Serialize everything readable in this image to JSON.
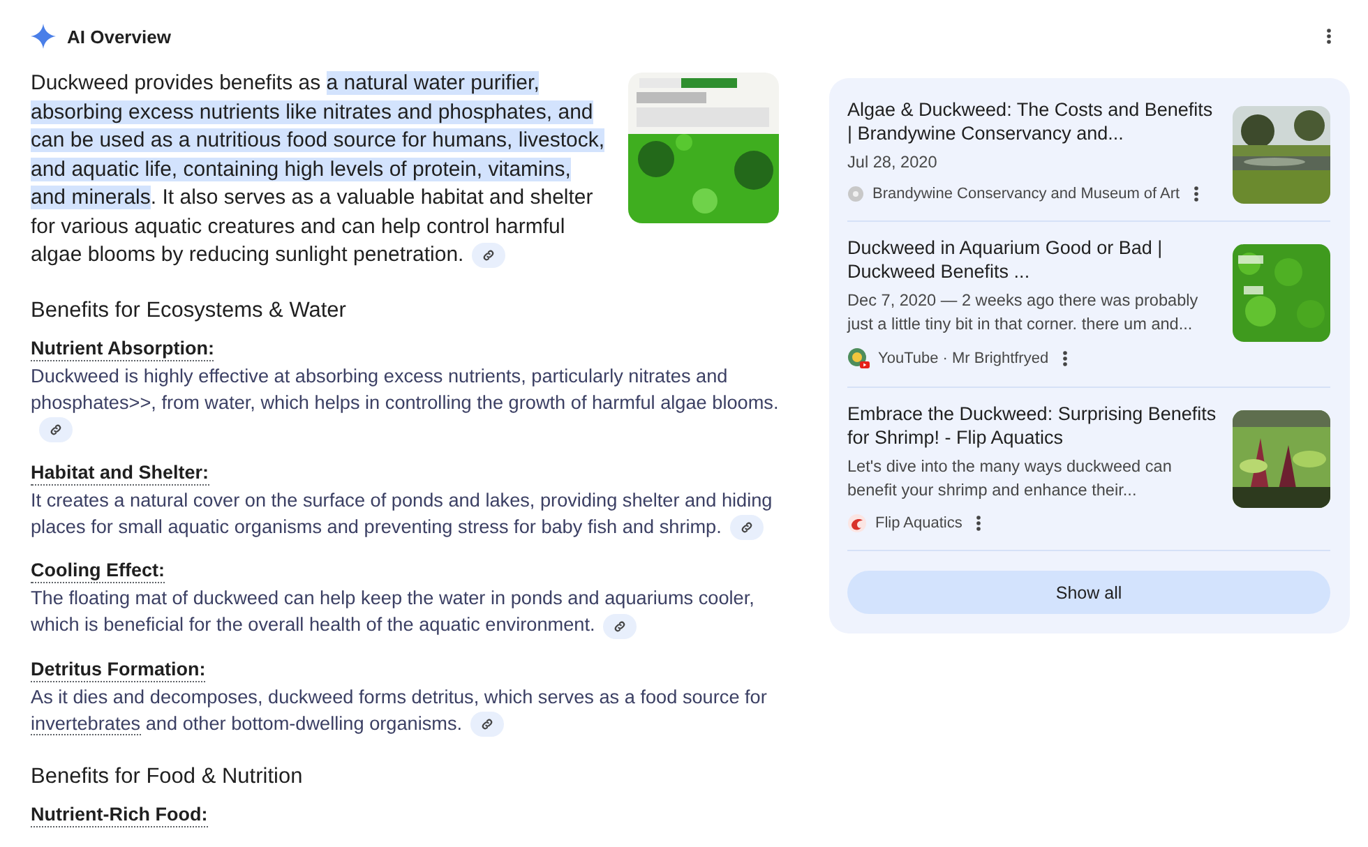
{
  "header": {
    "title": "AI Overview"
  },
  "intro": {
    "segments": [
      {
        "text": "Duckweed provides benefits as ",
        "highlighted": false
      },
      {
        "text": "a natural water purifier, absorbing excess nutrients like nitrates and phosphates, and can be used as a nutritious food source for humans, livestock, and aquatic life, containing high levels of protein, vitamins, and minerals",
        "highlighted": true
      },
      {
        "text": ". It also serves as a valuable habitat and shelter for various aquatic creatures and can help control harmful algae blooms by reducing sunlight penetration.",
        "highlighted": false
      }
    ]
  },
  "sections": [
    {
      "heading": "Benefits for Ecosystems & Water",
      "items": [
        {
          "term": "Nutrient Absorption:",
          "segments": [
            {
              "text": "Duckweed is highly effective at absorbing excess nutrients, particularly nitrates and phosphates>>, from water, which helps in controlling the growth of harmful algae blooms.",
              "term": false
            }
          ]
        },
        {
          "term": "Habitat and Shelter:",
          "segments": [
            {
              "text": "It creates a natural cover on the surface of ponds and lakes, providing shelter and hiding places for small aquatic organisms and preventing stress for baby fish and shrimp.",
              "term": false
            }
          ]
        },
        {
          "term": "Cooling Effect:",
          "segments": [
            {
              "text": "The floating mat of duckweed can help keep the water in ponds and aquariums cooler, which is beneficial for the overall health of the aquatic environment.",
              "term": false
            }
          ]
        },
        {
          "term": "Detritus Formation:",
          "segments": [
            {
              "text": "As it dies and decomposes, duckweed forms detritus, which serves as a food source for ",
              "term": false
            },
            {
              "text": "invertebrates",
              "term": true
            },
            {
              "text": " and other bottom-dwelling organisms.",
              "term": false
            }
          ]
        }
      ]
    },
    {
      "heading": "Benefits for Food & Nutrition",
      "items": [
        {
          "term": "Nutrient-Rich Food:"
        }
      ]
    }
  ],
  "sources": [
    {
      "title": "Algae & Duckweed: The Costs and Benefits | Brandywine Conservancy and...",
      "snippet": "Jul 28, 2020",
      "site": "Brandywine Conservancy and Museum of Art",
      "kind": "web"
    },
    {
      "title": "Duckweed in Aquarium Good or Bad | Duckweed Benefits ...",
      "snippet": "Dec 7, 2020 — 2 weeks ago there was probably just a little tiny bit in that corner. there um and...",
      "site": "YouTube · Mr Brightfryed",
      "kind": "video"
    },
    {
      "title": "Embrace the Duckweed: Surprising Benefits for Shrimp! - Flip Aquatics",
      "snippet": "Let's dive into the many ways duckweed can benefit your shrimp and enhance their...",
      "site": "Flip Aquatics",
      "kind": "shop"
    }
  ],
  "show_all": "Show all"
}
